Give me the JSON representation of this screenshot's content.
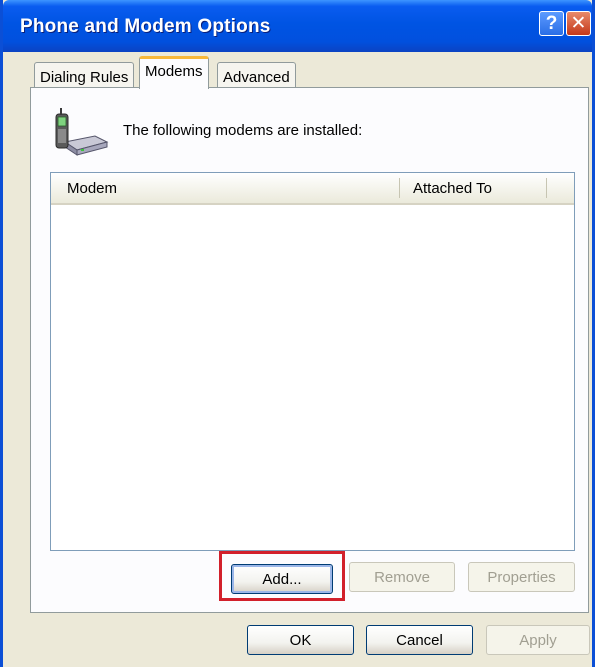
{
  "window": {
    "title": "Phone and Modem Options",
    "help_glyph": "?",
    "close_glyph": "✕"
  },
  "tabs": [
    {
      "label": "Dialing Rules",
      "active": false
    },
    {
      "label": "Modems",
      "active": true
    },
    {
      "label": "Advanced",
      "active": false
    }
  ],
  "modems_panel": {
    "intro_text": "The following modems are installed:",
    "icon": "phone-modem-icon",
    "columns": [
      "Modem",
      "Attached To"
    ],
    "rows": [],
    "buttons": {
      "add": "Add...",
      "remove": "Remove",
      "properties": "Properties"
    }
  },
  "dialog_buttons": {
    "ok": "OK",
    "cancel": "Cancel",
    "apply": "Apply"
  },
  "colors": {
    "title_bar": "#0054e3",
    "highlight_box": "#d2202b",
    "active_tab_accent": "#f8b83a"
  }
}
